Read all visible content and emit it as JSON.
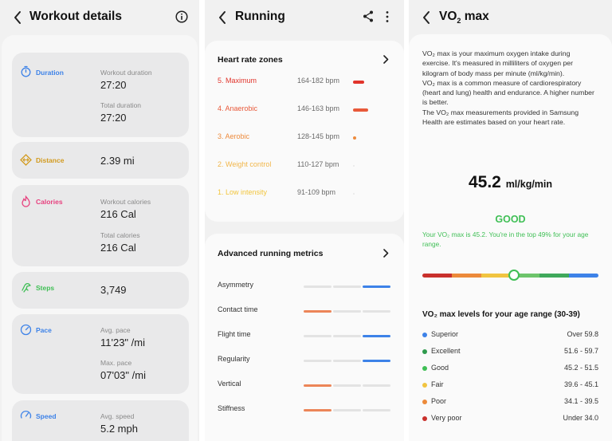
{
  "screens": {
    "workout": {
      "title": "Workout details",
      "metrics": [
        {
          "label": "Duration",
          "icon": "stopwatch-icon",
          "color": "#3d82e8",
          "sub1": "Workout duration",
          "val1": "27:20",
          "sub2": "Total duration",
          "val2": "27:20"
        },
        {
          "label": "Distance",
          "icon": "distance-icon",
          "color": "#d29a1e",
          "val1": "2.39 mi"
        },
        {
          "label": "Calories",
          "icon": "flame-icon",
          "color": "#e7407e",
          "sub1": "Workout calories",
          "val1": "216 Cal",
          "sub2": "Total calories",
          "val2": "216 Cal"
        },
        {
          "label": "Steps",
          "icon": "steps-icon",
          "color": "#3fbf55",
          "val1": "3,749"
        },
        {
          "label": "Pace",
          "icon": "pace-icon",
          "color": "#3d82e8",
          "sub1": "Avg. pace",
          "val1": "11'23\" /mi",
          "sub2": "Max. pace",
          "val2": "07'03\" /mi"
        },
        {
          "label": "Speed",
          "icon": "speed-icon",
          "color": "#3d82e8",
          "sub1": "Avg. speed",
          "val1": "5.2 mph"
        }
      ]
    },
    "running": {
      "title": "Running",
      "hr_title": "Heart rate zones",
      "zones": [
        {
          "name": "5. Maximum",
          "bpm": "164-182 bpm",
          "color": "#e1342b",
          "bar_fraction": 0.12
        },
        {
          "name": "4. Anaerobic",
          "bpm": "146-163 bpm",
          "color": "#e8593a",
          "bar_fraction": 0.16
        },
        {
          "name": "3. Aerobic",
          "bpm": "128-145 bpm",
          "color": "#ed8b3d",
          "bar_fraction": 0.0
        },
        {
          "name": "2. Weight control",
          "bpm": "110-127 bpm",
          "color": "#f1b64a",
          "bar_fraction": 0.0
        },
        {
          "name": "1. Low intensity",
          "bpm": "91-109 bpm",
          "color": "#f2c53d",
          "bar_fraction": 0.0
        }
      ],
      "metrics_title": "Advanced running metrics",
      "metrics": [
        {
          "name": "Asymmetry",
          "level": 3,
          "color": "#3d82e8"
        },
        {
          "name": "Contact time",
          "level": 1,
          "color": "#ec8558"
        },
        {
          "name": "Flight time",
          "level": 3,
          "color": "#3d82e8"
        },
        {
          "name": "Regularity",
          "level": 3,
          "color": "#3d82e8"
        },
        {
          "name": "Vertical",
          "level": 1,
          "color": "#ec8558"
        },
        {
          "name": "Stiffness",
          "level": 1,
          "color": "#ec8558"
        }
      ]
    },
    "vo2": {
      "title_main": "VO",
      "title_sub": "2",
      "title_rest": " max",
      "description": [
        "VO₂ max is your maximum oxygen intake during exercise. It's measured in milliliters of oxygen per kilogram of body mass per minute (ml/kg/min).",
        "VO₂ max is a common measure of cardiorespiratory (heart and lung) health and endurance. A higher number is better.",
        "The VO₂ max measurements provided in Samsung Health are estimates based on your heart rate."
      ],
      "value": "45.2",
      "unit": "ml/kg/min",
      "rating": "GOOD",
      "rating_desc": "Your VO₂ max is 45.2. You're in the top 49% for your age range.",
      "scale_colors": [
        "#c9302c",
        "#ec8a3a",
        "#f1c440",
        "#6dc46b",
        "#3fa95b",
        "#3d82e8"
      ],
      "marker_fraction": 0.52,
      "levels_title": "VO₂ max levels for your age range (30-39)",
      "levels": [
        {
          "name": "Superior",
          "range": "Over 59.8",
          "color": "#3d82e8"
        },
        {
          "name": "Excellent",
          "range": "51.6 - 59.7",
          "color": "#2e9a4d"
        },
        {
          "name": "Good",
          "range": "45.2 - 51.5",
          "color": "#3fbf55"
        },
        {
          "name": "Fair",
          "range": "39.6 - 45.1",
          "color": "#f1c440"
        },
        {
          "name": "Poor",
          "range": "34.1 - 39.5",
          "color": "#ec8a3a"
        },
        {
          "name": "Very poor",
          "range": "Under 34.0",
          "color": "#c9302c"
        }
      ]
    }
  }
}
